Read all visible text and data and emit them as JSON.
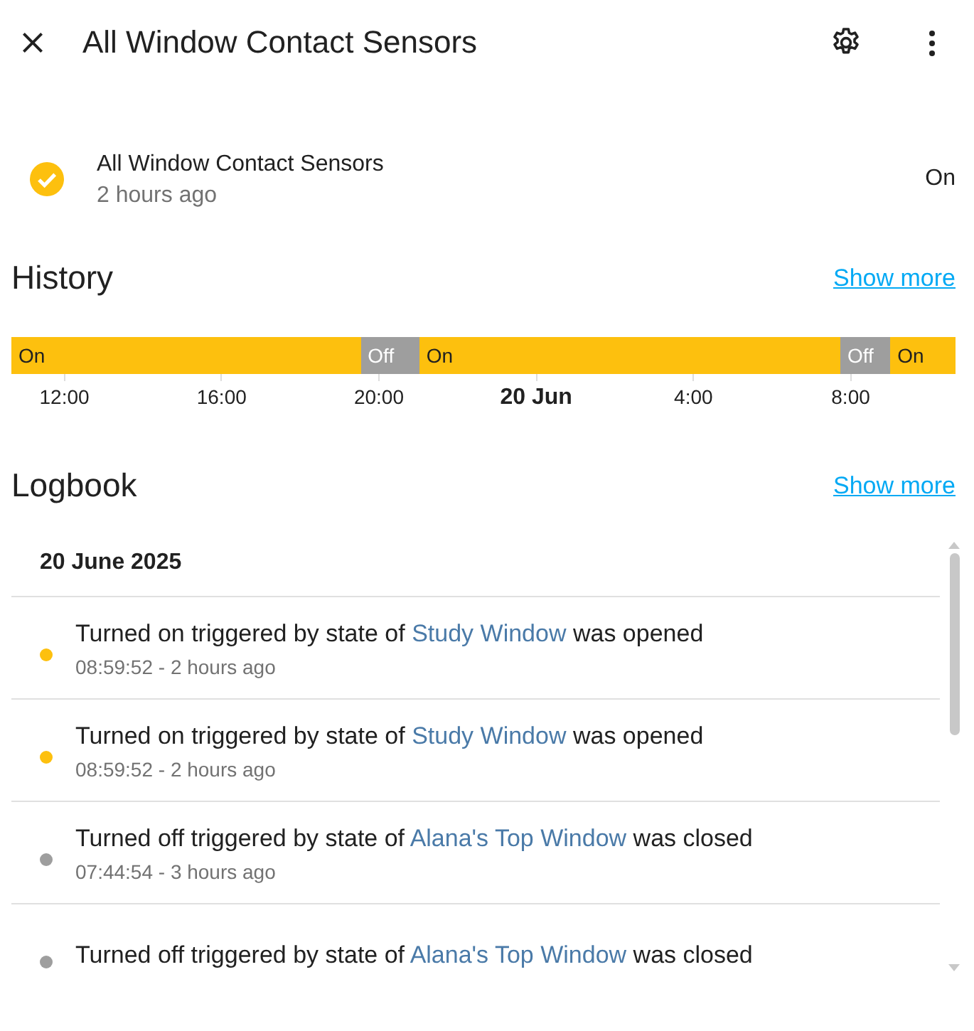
{
  "header": {
    "title": "All Window Contact Sensors"
  },
  "entity": {
    "name": "All Window Contact Sensors",
    "changed": "2 hours ago",
    "state": "On"
  },
  "history": {
    "title": "History",
    "show_more": "Show more",
    "segments": [
      {
        "label": "On",
        "kind": "on"
      },
      {
        "label": "Off",
        "kind": "off"
      },
      {
        "label": "On",
        "kind": "on"
      },
      {
        "label": "Off",
        "kind": "off"
      },
      {
        "label": "On",
        "kind": "on"
      }
    ],
    "ticks": [
      {
        "label": "12:00",
        "kind": "time"
      },
      {
        "label": "16:00",
        "kind": "time"
      },
      {
        "label": "20:00",
        "kind": "time"
      },
      {
        "label": "20 Jun",
        "kind": "date"
      },
      {
        "label": "4:00",
        "kind": "time"
      },
      {
        "label": "8:00",
        "kind": "time"
      }
    ]
  },
  "logbook": {
    "title": "Logbook",
    "show_more": "Show more",
    "date": "20 June 2025",
    "entries": [
      {
        "message": "Turned on triggered by state of",
        "entity": "Study Window",
        "suffix": "was opened",
        "time": "08:59:52 - 2 hours ago",
        "color": "#fdc00e"
      },
      {
        "message": "Turned on triggered by state of",
        "entity": "Study Window",
        "suffix": "was opened",
        "time": "08:59:52 - 2 hours ago",
        "color": "#fdc00e"
      },
      {
        "message": "Turned off triggered by state of",
        "entity": "Alana's Top Window",
        "suffix": "was closed",
        "time": "07:44:54 - 3 hours ago",
        "color": "#9e9e9e"
      },
      {
        "message": "Turned off triggered by state of",
        "entity": "Alana's Top Window",
        "suffix": "was closed",
        "color": "#9e9e9e"
      }
    ]
  }
}
